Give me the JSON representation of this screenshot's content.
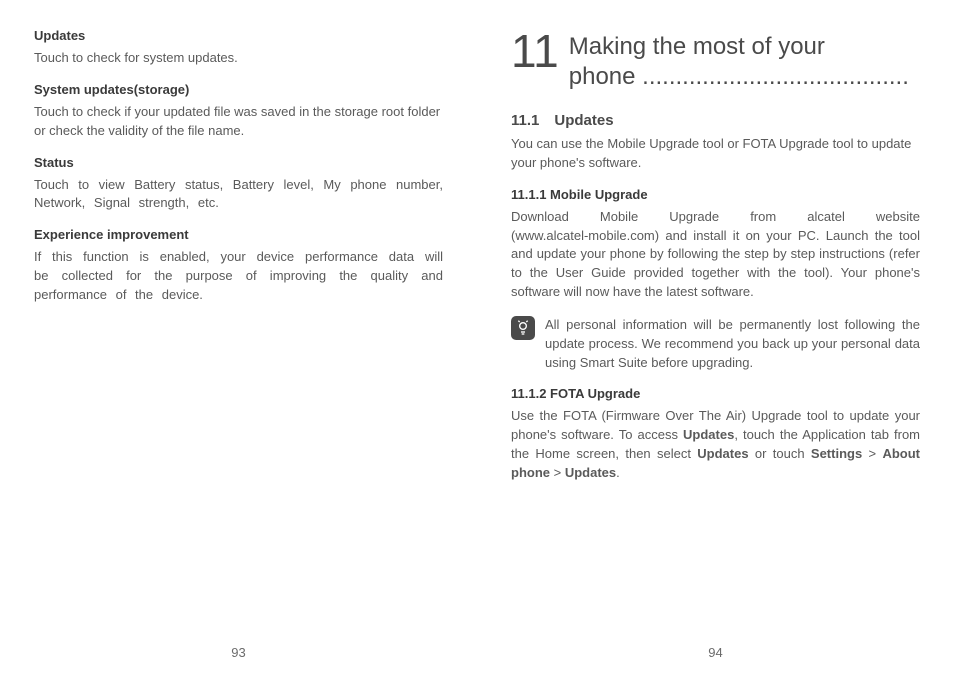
{
  "left": {
    "pageNum": "93",
    "items": [
      {
        "heading": "Updates",
        "body": "Touch to check for system updates."
      },
      {
        "heading": "System updates(storage)",
        "body": "Touch to check if your updated file was saved in the storage root folder or check the validity of the file name."
      },
      {
        "heading": "Status",
        "body": "Touch to view Battery status, Battery level, My phone number, Network, Signal strength, etc."
      },
      {
        "heading": "Experience improvement",
        "body": "If this function is enabled, your device performance data will be collected for the purpose of improving the quality and performance of the device."
      }
    ]
  },
  "right": {
    "pageNum": "94",
    "chapter": {
      "num": "11",
      "title_line1": "Making the most of your",
      "title_line2": "phone ........................................"
    },
    "section": {
      "num_title": "11.1 Updates",
      "intro": "You can use the Mobile Upgrade tool or FOTA Upgrade tool to update your phone's software."
    },
    "sub1": {
      "heading": "11.1.1 Mobile Upgrade",
      "para": "Download Mobile Upgrade from alcatel website (www.alcatel-mobile.com) and install it on your PC. Launch the tool and update your phone by following the step by step instructions (refer to the User Guide provided together with the tool). Your phone's software will now have the latest software.",
      "tip": "All personal information will be permanently lost following the update process. We recommend you back up your personal data using Smart Suite before upgrading."
    },
    "sub2": {
      "heading": "11.1.2 FOTA Upgrade",
      "para_pre": "Use the FOTA (Firmware Over The Air) Upgrade tool to update your phone's software. To access ",
      "bold1": "Updates",
      "mid1": ", touch the Application tab from the Home screen, then select ",
      "bold2": "Updates",
      "mid2": " or touch ",
      "bold3": "Settings",
      "gt": " > ",
      "bold4": "About phone",
      "mid3": " > ",
      "bold5": "Updates",
      "end": "."
    }
  }
}
